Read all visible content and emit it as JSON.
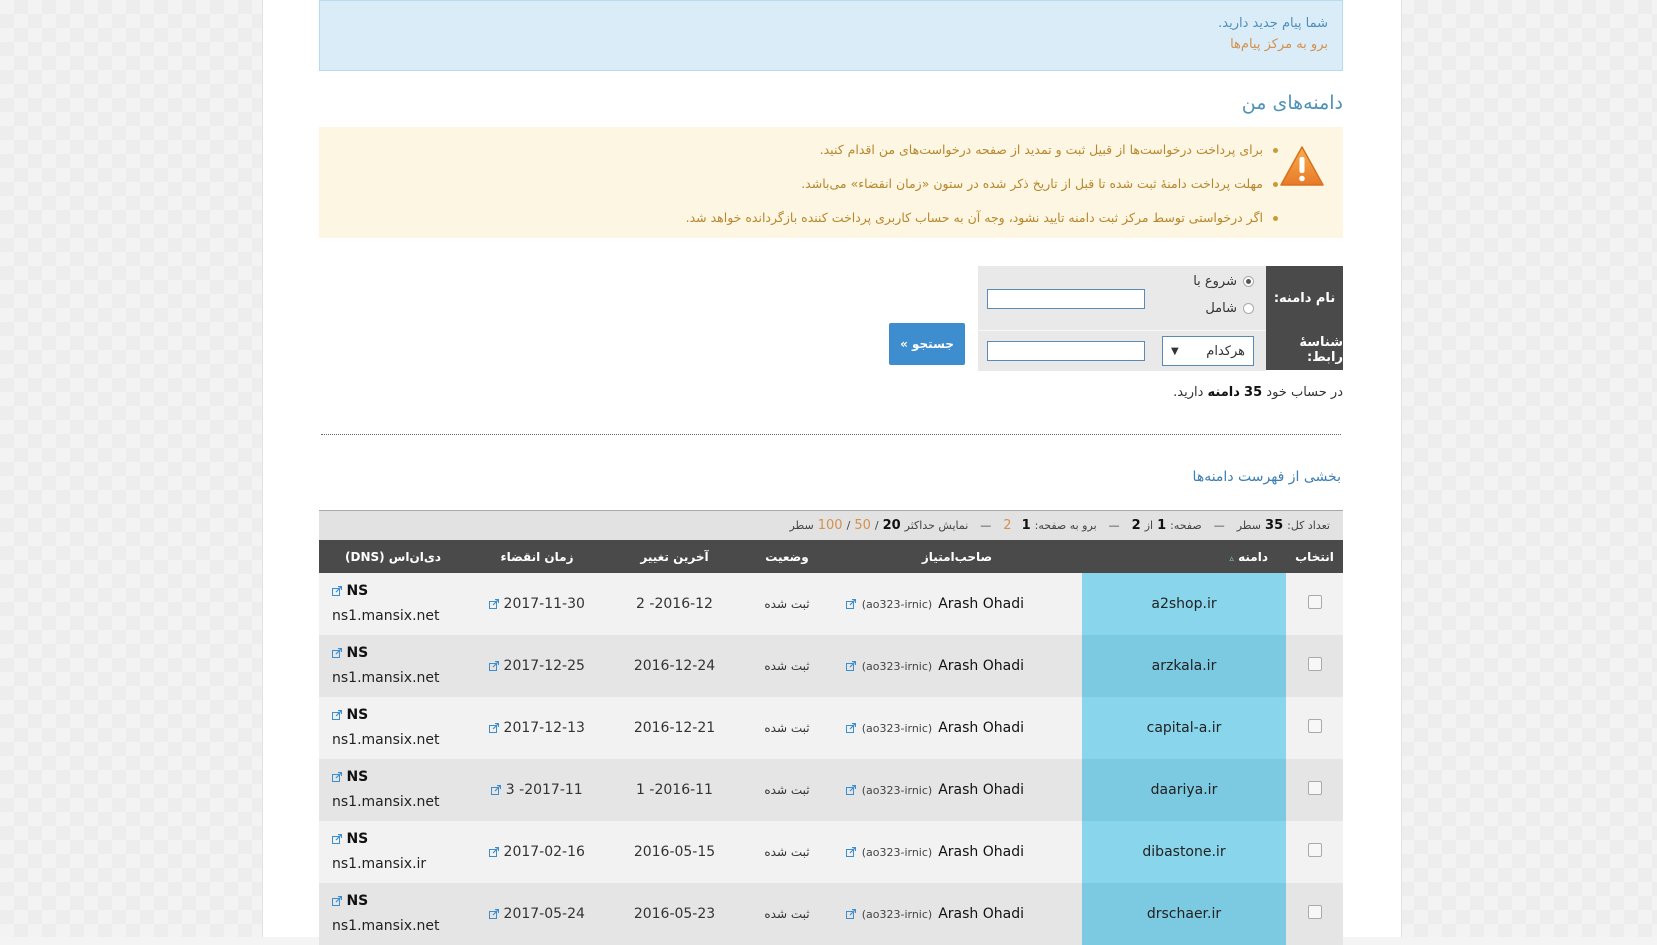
{
  "messages": {
    "new_message": "شما پیام جدید دارید.",
    "go_to_center": "برو به مرکز پیام‌ها"
  },
  "page_title": "دامنه‌های من",
  "warnings": [
    "برای پرداخت درخواست‌ها از قبیل ثبت و تمدید از صفحه درخواست‌های من اقدام کنید.",
    "مهلت پرداخت دامنهٔ ثبت شده تا قبل از تاریخ ذکر شده در ستون «زمان انقضاء» می‌باشد.",
    "اگر درخواستی توسط مرکز ثبت دامنه تایید نشود، وجه آن به حساب کاربری پرداخت کننده بازگردانده خواهد شد."
  ],
  "search": {
    "domain_label": "نام دامنه:",
    "contact_label": "شناسهٔ رابط:",
    "radio_starts": "شروع با",
    "radio_contains": "شامل",
    "select_value": "هرکدام",
    "button": "جستجو »"
  },
  "count": {
    "prefix": "در حساب خود",
    "number": "35",
    "unit": "دامنه",
    "suffix": "دارید."
  },
  "list_title": "بخشی از فهرست دامنه‌ها",
  "pager": {
    "total_label": "تعداد کل:",
    "total": "35",
    "rows_word": "سطر",
    "page_label": "صفحه:",
    "page": "1",
    "of_word": "از",
    "pages": "2",
    "goto_label": "برو به صفحه:",
    "goto_current": "1",
    "goto_other": "2",
    "show_max_label": "نمایش حداکثر",
    "size_current": "20",
    "size_50": "50",
    "size_100": "100",
    "dash": "—"
  },
  "columns": {
    "select": "انتخاب",
    "domain": "دامنه",
    "owner": "صاحب‌امتیاز",
    "status": "وضعیت",
    "last_change": "آخرین تغییر",
    "expire": "زمان انقضاء",
    "dns": "دی‌ان‌اس (DNS)"
  },
  "rows": [
    {
      "domain": "a2shop.ir",
      "owner": "Arash Ohadi",
      "handle": "(ao323-irnic)",
      "status": "ثبت شده",
      "last_change": "2016-12- 2",
      "expire": "2017-11-30",
      "ns": "NS",
      "ns_host": "ns1.mansix.net"
    },
    {
      "domain": "arzkala.ir",
      "owner": "Arash Ohadi",
      "handle": "(ao323-irnic)",
      "status": "ثبت شده",
      "last_change": "2016-12-24",
      "expire": "2017-12-25",
      "ns": "NS",
      "ns_host": "ns1.mansix.net"
    },
    {
      "domain": "capital-a.ir",
      "owner": "Arash Ohadi",
      "handle": "(ao323-irnic)",
      "status": "ثبت شده",
      "last_change": "2016-12-21",
      "expire": "2017-12-13",
      "ns": "NS",
      "ns_host": "ns1.mansix.net"
    },
    {
      "domain": "daariya.ir",
      "owner": "Arash Ohadi",
      "handle": "(ao323-irnic)",
      "status": "ثبت شده",
      "last_change": "2016-11- 1",
      "expire": "2017-11- 3",
      "ns": "NS",
      "ns_host": "ns1.mansix.net"
    },
    {
      "domain": "dibastone.ir",
      "owner": "Arash Ohadi",
      "handle": "(ao323-irnic)",
      "status": "ثبت شده",
      "last_change": "2016-05-15",
      "expire": "2017-02-16",
      "ns": "NS",
      "ns_host": "ns1.mansix.ir"
    },
    {
      "domain": "drschaer.ir",
      "owner": "Arash Ohadi",
      "handle": "(ao323-irnic)",
      "status": "ثبت شده",
      "last_change": "2016-05-23",
      "expire": "2017-05-24",
      "ns": "NS",
      "ns_host": "ns1.mansix.net"
    }
  ],
  "colors": {
    "info_bg": "#d9ecf7",
    "warning_bg": "#fdf6e3",
    "header_bg": "#4a4a4a",
    "domain_cell": "#89d6ec",
    "button": "#3d8dcf"
  }
}
